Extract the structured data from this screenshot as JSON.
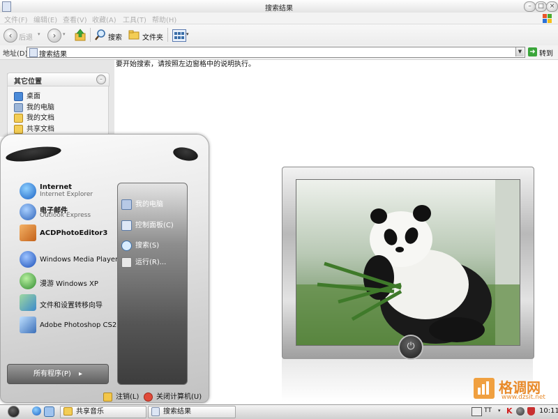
{
  "window": {
    "title": "搜索结果",
    "buttons": {
      "minimize": "–",
      "maximize": "□",
      "close": "×"
    }
  },
  "menubar": {
    "items": [
      "文件(F)",
      "编辑(E)",
      "查看(V)",
      "收藏(A)",
      "工具(T)",
      "帮助(H)"
    ]
  },
  "toolbar": {
    "back_label": "后退",
    "search_label": "搜索",
    "folders_label": "文件夹"
  },
  "addressbar": {
    "label": "地址(D)",
    "value": "搜索结果",
    "go_label": "转到"
  },
  "hint_text": "要开始搜索，请按照左边窗格中的说明执行。",
  "other_places": {
    "header": "其它位置",
    "items": [
      {
        "label": "桌面",
        "icon": "desktop-icon"
      },
      {
        "label": "我的电脑",
        "icon": "computer-icon"
      },
      {
        "label": "我的文档",
        "icon": "documents-icon"
      },
      {
        "label": "共享文档",
        "icon": "shared-documents-icon"
      }
    ]
  },
  "start_menu": {
    "pinned": [
      {
        "label": "Internet",
        "sub": "Internet Explorer",
        "icon": "internet-explorer-icon",
        "color": "#2a7fd8"
      },
      {
        "label": "电子邮件",
        "sub": "Outlook Express",
        "icon": "outlook-express-icon",
        "color": "#3d7ed6"
      }
    ],
    "programs": [
      {
        "label": "ACDPhotoEditor3",
        "icon": "acd-photo-editor-icon",
        "color": "#c4621a"
      },
      {
        "label": "Windows Media Player",
        "icon": "media-player-icon",
        "color": "#2a5fd8"
      },
      {
        "label": "漫游 Windows XP",
        "icon": "windows-tour-icon",
        "color": "#3c9a3c"
      },
      {
        "label": "文件和设置转移向导",
        "icon": "transfer-wizard-icon",
        "color": "#3c8acc"
      },
      {
        "label": "Adobe Photoshop CS2",
        "icon": "photoshop-icon",
        "color": "#3b6fb8"
      }
    ],
    "all_programs": "所有程序(P)",
    "right_items": [
      {
        "label": "我的电脑",
        "icon": "computer-icon"
      },
      {
        "label": "控制面板(C)",
        "icon": "control-panel-icon"
      },
      {
        "label": "搜索(S)",
        "icon": "search-icon"
      },
      {
        "label": "运行(R)...",
        "icon": "run-icon"
      }
    ],
    "logoff": "注销(L)",
    "shutdown": "关闭计算机(U)"
  },
  "watermark": {
    "title": "格调网",
    "url": "www.dzsit.net"
  },
  "taskbar": {
    "tasks": [
      "共享音乐",
      "搜索结果"
    ],
    "tray_tt": "TT",
    "time": "10:11"
  },
  "colors": {
    "accent_orange": "#f0a040",
    "go_green": "#3aa53a"
  }
}
